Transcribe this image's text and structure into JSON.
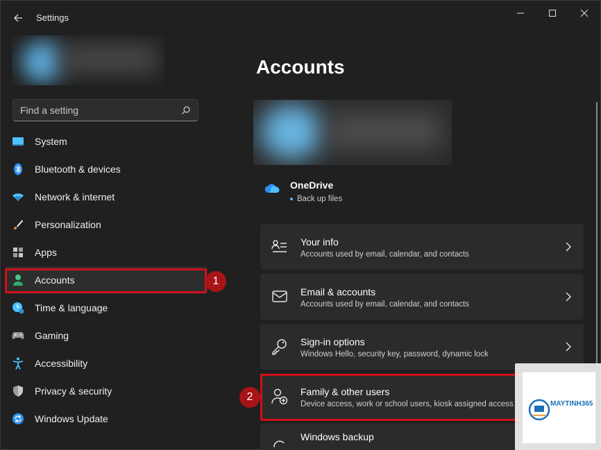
{
  "window": {
    "title": "Settings"
  },
  "search": {
    "placeholder": "Find a setting"
  },
  "sidebar": {
    "items": [
      {
        "label": "System",
        "icon": "monitor-icon"
      },
      {
        "label": "Bluetooth & devices",
        "icon": "bluetooth-icon"
      },
      {
        "label": "Network & internet",
        "icon": "wifi-icon"
      },
      {
        "label": "Personalization",
        "icon": "brush-icon"
      },
      {
        "label": "Apps",
        "icon": "apps-icon"
      },
      {
        "label": "Accounts",
        "icon": "person-icon",
        "selected": true
      },
      {
        "label": "Time & language",
        "icon": "clock-globe-icon"
      },
      {
        "label": "Gaming",
        "icon": "gamepad-icon"
      },
      {
        "label": "Accessibility",
        "icon": "accessibility-icon"
      },
      {
        "label": "Privacy & security",
        "icon": "shield-icon"
      },
      {
        "label": "Windows Update",
        "icon": "update-icon"
      }
    ]
  },
  "main": {
    "page_title": "Accounts",
    "onedrive": {
      "title": "OneDrive",
      "subtitle": "Back up files"
    },
    "cards": [
      {
        "title": "Your info",
        "subtitle": "Accounts used by email, calendar, and contacts",
        "icon": "id-card-icon"
      },
      {
        "title": "Email & accounts",
        "subtitle": "Accounts used by email, calendar, and contacts",
        "icon": "mail-icon"
      },
      {
        "title": "Sign-in options",
        "subtitle": "Windows Hello, security key, password, dynamic lock",
        "icon": "key-icon"
      },
      {
        "title": "Family & other users",
        "subtitle": "Device access, work or school users, kiosk assigned access",
        "icon": "person-add-icon"
      },
      {
        "title": "Windows backup",
        "subtitle": "",
        "icon": "backup-icon"
      }
    ]
  },
  "annotations": {
    "step1": "1",
    "step2": "2",
    "highlight_color": "#d0101a"
  },
  "watermark": {
    "brand": "MAYTINH365"
  },
  "colors": {
    "accent": "#4cc2ff",
    "background": "#202020",
    "card": "#2b2b2b"
  }
}
